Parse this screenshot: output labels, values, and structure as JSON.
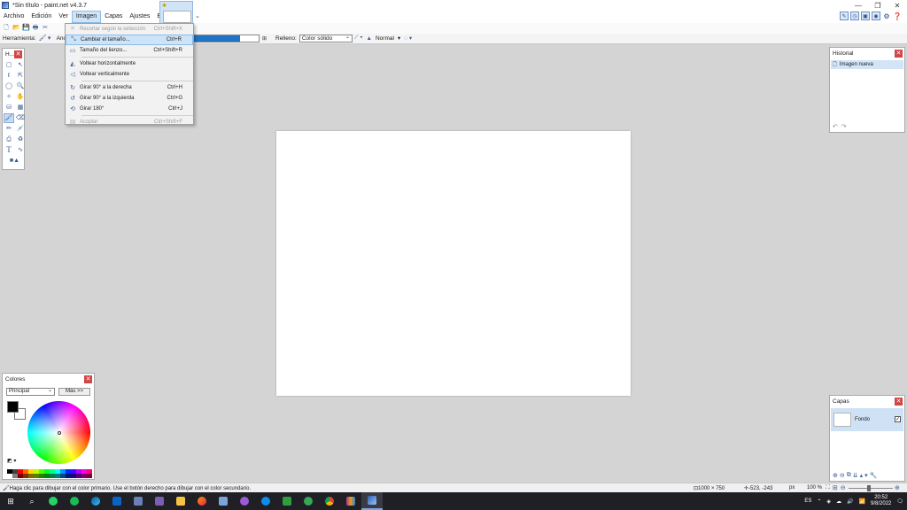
{
  "window": {
    "title": "*Sin título - paint.net v4.3.7",
    "controls": [
      "—",
      "❐",
      "✕"
    ]
  },
  "menubar": {
    "items": [
      "Archivo",
      "Edición",
      "Ver",
      "Imagen",
      "Capas",
      "Ajustes",
      "Efectos"
    ],
    "active": "Imagen"
  },
  "toolbar2": {
    "tool_label": "Herramienta:",
    "width_label": "Anc",
    "fill_label": "Relleno:",
    "fill_value": "Color sólido",
    "blend_mode": "Normal"
  },
  "image_menu": {
    "items": [
      {
        "label": "Recortar según la selección",
        "shortcut": "Ctrl+Shift+X",
        "state": "disabled",
        "icon": "crop-icon"
      },
      {
        "label": "Cambiar el tamaño...",
        "shortcut": "Ctrl+R",
        "state": "hover",
        "icon": "resize-icon"
      },
      {
        "label": "Tamaño del lienzo...",
        "shortcut": "Ctrl+Shift+R",
        "state": "normal",
        "icon": "canvas-size-icon"
      },
      {
        "label": "Voltear horizontalmente",
        "shortcut": "",
        "state": "normal",
        "icon": "flip-horizontal-icon"
      },
      {
        "label": "Voltear verticalmente",
        "shortcut": "",
        "state": "normal",
        "icon": "flip-vertical-icon"
      },
      {
        "label": "Girar 90° a la derecha",
        "shortcut": "Ctrl+H",
        "state": "normal",
        "icon": "rotate-right-icon"
      },
      {
        "label": "Girar 90° a la izquierda",
        "shortcut": "Ctrl+G",
        "state": "normal",
        "icon": "rotate-left-icon"
      },
      {
        "label": "Girar 180°",
        "shortcut": "Ctrl+J",
        "state": "normal",
        "icon": "rotate-180-icon"
      },
      {
        "label": "Acoplar",
        "shortcut": "Ctrl+Shift+F",
        "state": "disabled",
        "icon": "flatten-icon"
      }
    ]
  },
  "tools_panel": {
    "title": "H..."
  },
  "history_panel": {
    "title": "Historial",
    "items": [
      "Imagen nueva"
    ]
  },
  "layers_panel": {
    "title": "Capas",
    "layers": [
      {
        "name": "Fondo",
        "visible": true
      }
    ]
  },
  "colors_panel": {
    "title": "Colores",
    "mode": "Principal",
    "more_button": "Más >>",
    "primary": "#000000",
    "secondary": "#ffffff"
  },
  "status": {
    "hint": "Haga clic para dibujar con el color primario. Use el botón derecho para dibujar con el color secundario.",
    "size": "1000 × 750",
    "coords": "-523, -243",
    "unit": "px",
    "zoom": "100 %"
  },
  "taskbar": {
    "lang": "ES",
    "time": "20:52",
    "date": "9/8/2022"
  }
}
